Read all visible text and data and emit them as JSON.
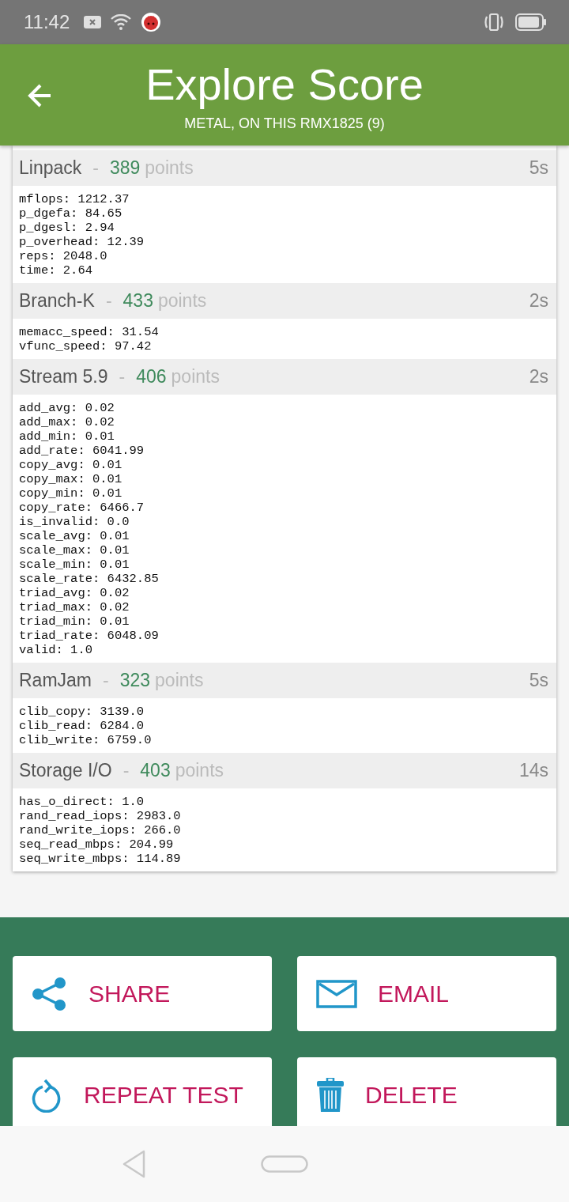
{
  "status_bar": {
    "time": "11:42"
  },
  "header": {
    "title": "Explore Score",
    "subtitle": "METAL, ON THIS RMX1825 (9)"
  },
  "sections": [
    {
      "name": "Linpack",
      "separator": "-",
      "score": "389",
      "unit": "points",
      "duration": "5s",
      "metrics": [
        "mflops: 1212.37",
        "p_dgefa: 84.65",
        "p_dgesl: 2.94",
        "p_overhead: 12.39",
        "reps: 2048.0",
        "time: 2.64"
      ]
    },
    {
      "name": "Branch-K",
      "separator": "-",
      "score": "433",
      "unit": "points",
      "duration": "2s",
      "metrics": [
        "memacc_speed: 31.54",
        "vfunc_speed: 97.42"
      ]
    },
    {
      "name": "Stream 5.9",
      "separator": "-",
      "score": "406",
      "unit": "points",
      "duration": "2s",
      "metrics": [
        "add_avg: 0.02",
        "add_max: 0.02",
        "add_min: 0.01",
        "add_rate: 6041.99",
        "copy_avg: 0.01",
        "copy_max: 0.01",
        "copy_min: 0.01",
        "copy_rate: 6466.7",
        "is_invalid: 0.0",
        "scale_avg: 0.01",
        "scale_max: 0.01",
        "scale_min: 0.01",
        "scale_rate: 6432.85",
        "triad_avg: 0.02",
        "triad_max: 0.02",
        "triad_min: 0.01",
        "triad_rate: 6048.09",
        "valid: 1.0"
      ]
    },
    {
      "name": "RamJam",
      "separator": "-",
      "score": "323",
      "unit": "points",
      "duration": "5s",
      "metrics": [
        "clib_copy: 3139.0",
        "clib_read: 6284.0",
        "clib_write: 6759.0"
      ]
    },
    {
      "name": "Storage I/O",
      "separator": "-",
      "score": "403",
      "unit": "points",
      "duration": "14s",
      "metrics": [
        "has_o_direct: 1.0",
        "rand_read_iops: 2983.0",
        "rand_write_iops: 266.0",
        "seq_read_mbps: 204.99",
        "seq_write_mbps: 114.89"
      ]
    }
  ],
  "actions": [
    {
      "label": "SHARE",
      "kind": "share"
    },
    {
      "label": "EMAIL",
      "kind": "email"
    },
    {
      "label": "REPEAT TEST",
      "kind": "repeat"
    },
    {
      "label": "DELETE",
      "kind": "delete"
    }
  ]
}
